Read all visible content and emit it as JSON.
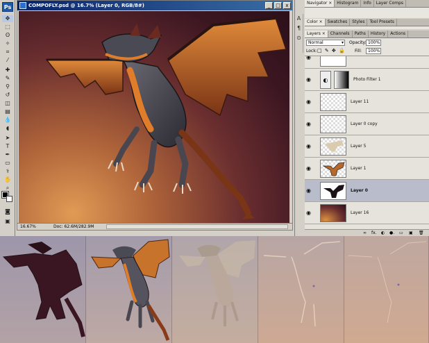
{
  "document": {
    "title": "COMPOFLY.psd @ 16.7% (Layer 0, RGB/8#)",
    "zoom": "16.67%",
    "doc_size": "Doc: 62.6M/282.9M",
    "controls": {
      "minimize": "_",
      "maximize": "□",
      "close": "x"
    }
  },
  "tools": {
    "logo": "Ps"
  },
  "panels": {
    "top_tabs": [
      "Navigator ×",
      "Histogram",
      "Info",
      "Layer Comps"
    ],
    "second_tabs": [
      "Color ×",
      "Swatches",
      "Styles",
      "Tool Presets"
    ],
    "layers_tabs": [
      "Layers ×",
      "Channels",
      "Paths",
      "History",
      "Actions"
    ],
    "icon_strip": [
      "A",
      "¶",
      "⊙"
    ]
  },
  "layers": {
    "blend_mode": "Normal",
    "opacity_label": "Opacity:",
    "opacity_value": "100%",
    "lock_label": "Lock:",
    "lock_icons": "□ ✎ ✥ 🔒",
    "fill_label": "Fill:",
    "fill_value": "100%",
    "items": [
      {
        "name": "",
        "thumb": "white",
        "selected": false
      },
      {
        "name": "Photo Filter 1",
        "thumb": "adjustment",
        "selected": false
      },
      {
        "name": "Layer 11",
        "thumb": "transparent",
        "selected": false
      },
      {
        "name": "Layer 0 copy",
        "thumb": "transparent",
        "selected": false
      },
      {
        "name": "Layer 5",
        "thumb": "sketch",
        "selected": false
      },
      {
        "name": "Layer 1",
        "thumb": "dragon",
        "selected": false
      },
      {
        "name": "Layer 0",
        "thumb": "dragon-dark",
        "selected": true
      },
      {
        "name": "Layer 16",
        "thumb": "background",
        "selected": false
      }
    ],
    "footer_icons": [
      "∞",
      "fx.",
      "◐",
      "●.",
      "▭",
      "▣",
      "🗑"
    ]
  },
  "colors": {
    "title_bar": "#0a246a",
    "selected_layer": "#b8bccb",
    "panel_bg": "#d4d0c8"
  }
}
